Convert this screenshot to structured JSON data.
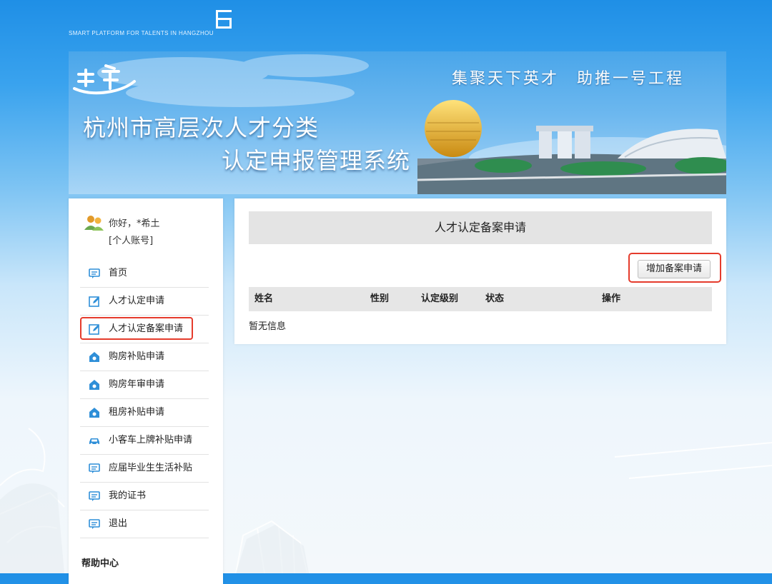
{
  "brand": {
    "tagline": "SMART PLATFORM FOR TALENTS IN HANGZHOU"
  },
  "banner": {
    "title_line1": "杭州市高层次人才分类",
    "title_line2": "认定申报管理系统",
    "slogan": "集聚天下英才　助推一号工程"
  },
  "user": {
    "greeting": "你好，*希土",
    "account_link": "[个人账号]"
  },
  "sidebar": {
    "items": [
      {
        "label": "首页",
        "icon": "comment-icon"
      },
      {
        "label": "人才认定申请",
        "icon": "edit-icon"
      },
      {
        "label": "人才认定备案申请",
        "icon": "edit-icon"
      },
      {
        "label": "购房补贴申请",
        "icon": "house-icon"
      },
      {
        "label": "购房年审申请",
        "icon": "house-icon"
      },
      {
        "label": "租房补贴申请",
        "icon": "house-icon"
      },
      {
        "label": "小客车上牌补贴申请",
        "icon": "car-icon"
      },
      {
        "label": "应届毕业生生活补贴",
        "icon": "comment-icon"
      },
      {
        "label": "我的证书",
        "icon": "comment-icon"
      },
      {
        "label": "退出",
        "icon": "comment-icon"
      }
    ],
    "help_title": "帮助中心"
  },
  "main": {
    "title": "人才认定备案申请",
    "add_button": "增加备案申请",
    "columns": [
      "姓名",
      "性别",
      "认定级别",
      "状态",
      "操作"
    ],
    "empty_text": "暂无信息"
  },
  "colors": {
    "highlight_border": "#e53b2c",
    "accent_blue": "#2f8fd8",
    "header_bg": "#e4e4e4"
  }
}
